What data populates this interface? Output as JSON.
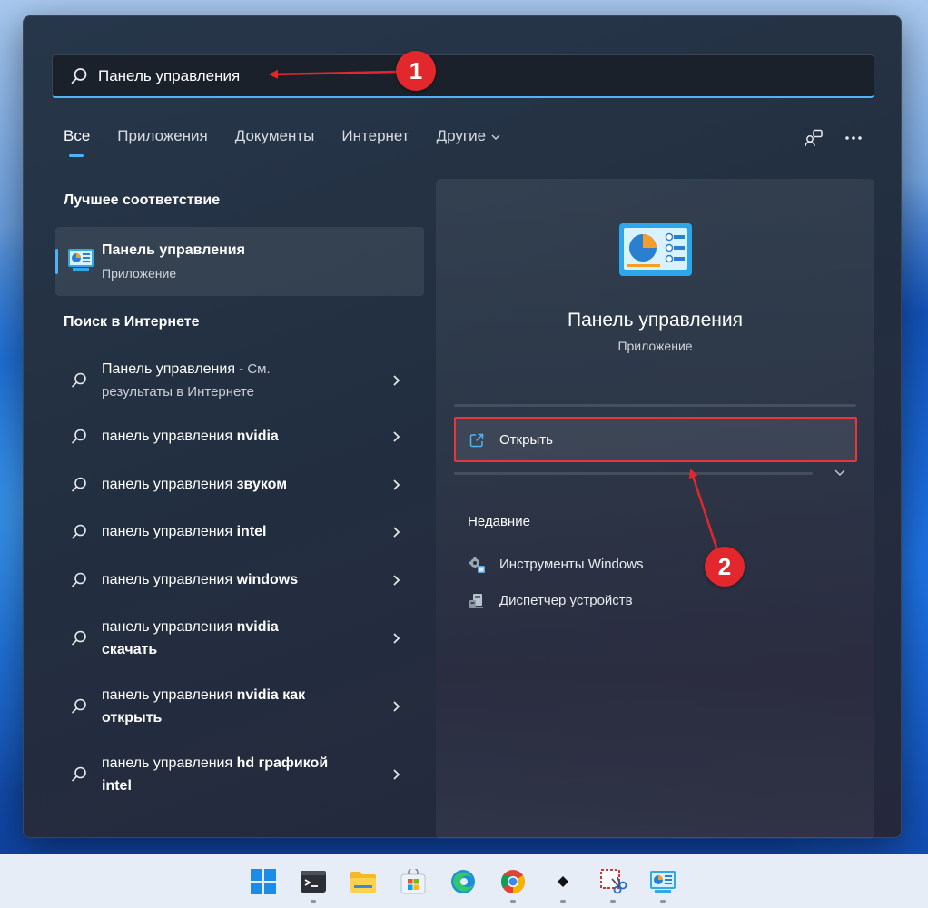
{
  "search": {
    "value": "Панель управления",
    "callout": "1"
  },
  "tabs": [
    {
      "label": "Все"
    },
    {
      "label": "Приложения"
    },
    {
      "label": "Документы"
    },
    {
      "label": "Интернет"
    },
    {
      "label": "Другие"
    }
  ],
  "best_match": {
    "heading": "Лучшее соответствие",
    "title": "Панель управления",
    "subtitle": "Приложение"
  },
  "web": {
    "heading": "Поиск в Интернете",
    "items": [
      {
        "text": "Панель управления",
        "bold": "",
        "suffix": " - См.",
        "line2": "результаты в Интернете"
      },
      {
        "text": "панель управления ",
        "bold": "nvidia",
        "suffix": "",
        "line2": ""
      },
      {
        "text": "панель управления ",
        "bold": "звуком",
        "suffix": "",
        "line2": ""
      },
      {
        "text": "панель управления ",
        "bold": "intel",
        "suffix": "",
        "line2": ""
      },
      {
        "text": "панель управления ",
        "bold": "windows",
        "suffix": "",
        "line2": ""
      },
      {
        "text": "панель управления ",
        "bold": "nvidia",
        "suffix": "",
        "line2": "скачать"
      },
      {
        "text": "панель управления ",
        "bold": "nvidia как",
        "suffix": "",
        "line2": "открыть"
      },
      {
        "text": "панель управления ",
        "bold": "hd графикой",
        "suffix": "",
        "line2": "intel"
      }
    ]
  },
  "preview": {
    "title": "Панель управления",
    "subtitle": "Приложение",
    "open_label": "Открыть",
    "recent_heading": "Недавние",
    "recent": [
      {
        "label": "Инструменты Windows",
        "icon": "windows-tools-icon"
      },
      {
        "label": "Диспетчер устройств",
        "icon": "device-manager-icon"
      }
    ],
    "callout": "2"
  },
  "colors": {
    "accent": "#4fb3f6",
    "annotation": "#e2272d"
  },
  "taskbar": {
    "icons": [
      "start-icon",
      "terminal-icon",
      "file-explorer-icon",
      "store-icon",
      "edge-icon",
      "chrome-icon",
      "unknown-app-icon",
      "snipping-tool-icon",
      "control-panel-icon"
    ]
  }
}
